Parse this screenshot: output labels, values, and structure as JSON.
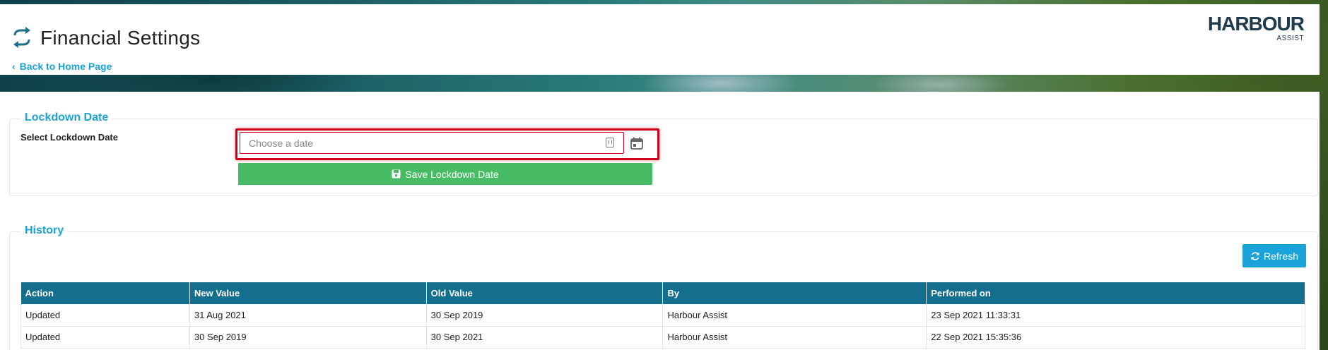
{
  "header": {
    "title": "Financial Settings",
    "back_link": "Back to Home Page",
    "logo_text": "HARBOUR",
    "logo_sub": "ASSIST"
  },
  "lockdown": {
    "legend": "Lockdown Date",
    "field_label": "Select Lockdown Date",
    "date_placeholder": "Choose a date",
    "date_value": "",
    "save_label": "Save Lockdown Date"
  },
  "history": {
    "legend": "History",
    "refresh_label": "Refresh",
    "columns": [
      "Action",
      "New Value",
      "Old Value",
      "By",
      "Performed on"
    ],
    "rows": [
      [
        "Updated",
        "31 Aug 2021",
        "30 Sep 2019",
        "Harbour Assist",
        "23 Sep 2021 11:33:31"
      ],
      [
        "Updated",
        "30 Sep 2019",
        "30 Sep 2021",
        "Harbour Assist",
        "22 Sep 2021 15:35:36"
      ]
    ]
  },
  "colors": {
    "accent": "#1aa3d9",
    "table_header": "#146f8e",
    "save_button": "#48bb65",
    "highlight": "#d0021b"
  },
  "icons": {
    "title": "exchange-arrows-icon",
    "back": "chevron-left-icon",
    "input": "clipboard-icon",
    "calendar": "calendar-icon",
    "save": "floppy-disk-icon",
    "refresh": "refresh-icon"
  }
}
